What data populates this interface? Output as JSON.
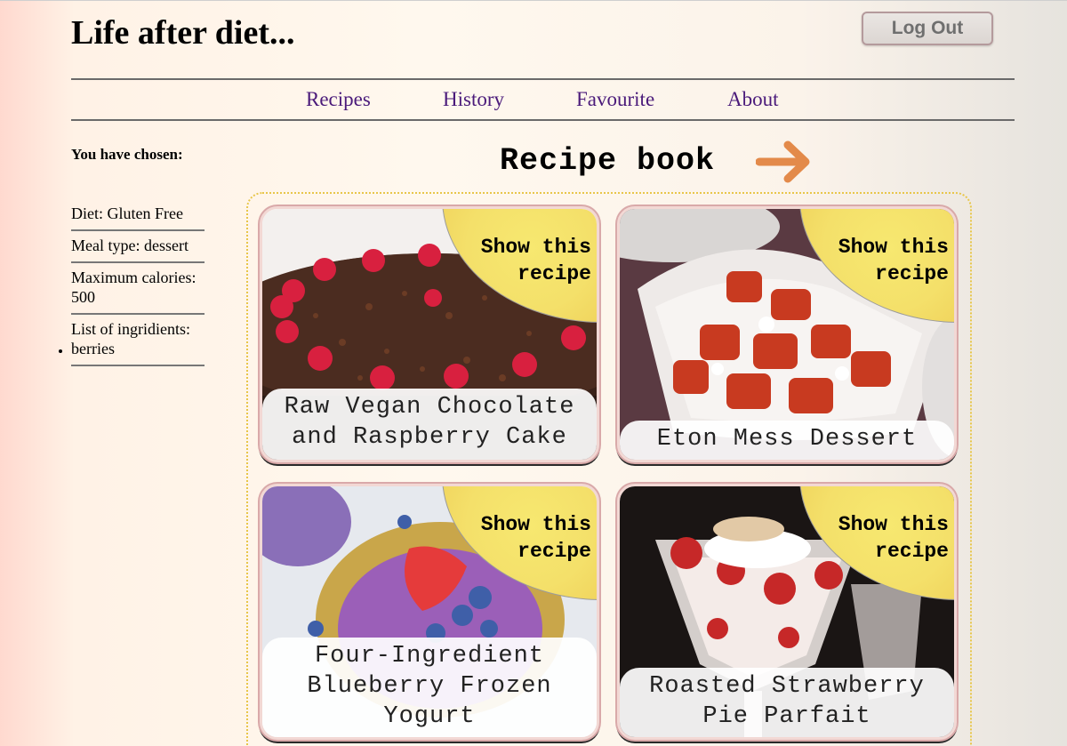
{
  "header": {
    "site_title": "Life after diet...",
    "logout_label": "Log Out"
  },
  "nav": {
    "items": [
      {
        "label": "Recipes"
      },
      {
        "label": "History"
      },
      {
        "label": "Favourite"
      },
      {
        "label": "About"
      }
    ]
  },
  "sidebar": {
    "title": "You have chosen:",
    "diet": "Diet: Gluten Free",
    "meal_type": "Meal type: dessert",
    "max_calories": "Maximum calories: 500",
    "ingredients_label": "List of ingridients:",
    "ingredients": [
      "berries"
    ]
  },
  "main": {
    "heading": "Recipe book",
    "arrow_icon": "arrow-right-icon",
    "show_label_line1": "Show this",
    "show_label_line2": "recipe",
    "recipes": [
      {
        "title": "Raw Vegan Chocolate and Raspberry Cake"
      },
      {
        "title": "Eton Mess Dessert"
      },
      {
        "title": "Four-Ingredient Blueberry Frozen Yogurt"
      },
      {
        "title": "Roasted Strawberry Pie Parfait"
      }
    ]
  },
  "colors": {
    "nav_link": "#4a1a7a",
    "show_badge": "#f4e06a",
    "arrow": "#e38a4a",
    "book_border": "#e8c64a"
  }
}
